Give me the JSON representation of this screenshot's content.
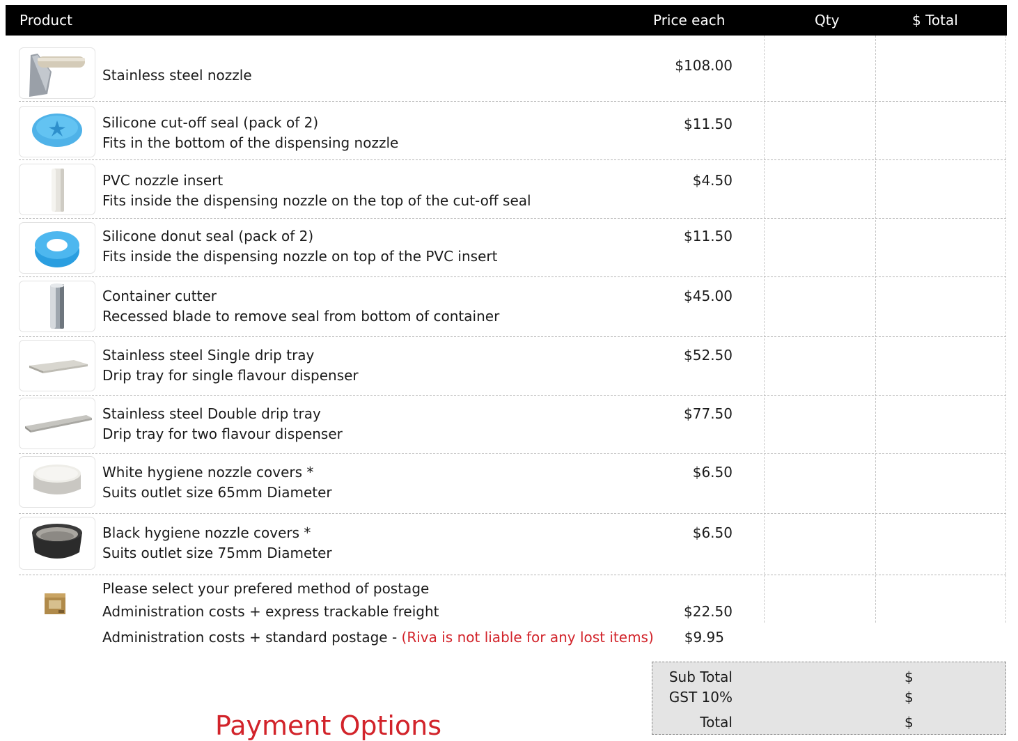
{
  "header": {
    "product": "Product",
    "price_each": "Price each",
    "qty": "Qty",
    "total": "$ Total"
  },
  "products": [
    {
      "name": "Stainless steel nozzle",
      "description": "",
      "price": "$108.00",
      "icon": "steel-nozzle"
    },
    {
      "name": "Silicone cut-off seal (pack of 2)",
      "description": "Fits in the bottom of the dispensing nozzle",
      "price": "$11.50",
      "icon": "cut-off-seal"
    },
    {
      "name": "PVC nozzle insert",
      "description": "Fits inside the dispensing nozzle on the top of the cut-off seal",
      "price": "$4.50",
      "icon": "pvc-insert"
    },
    {
      "name": "Silicone donut seal (pack of 2)",
      "description": "Fits inside the dispensing nozzle on top of the PVC insert",
      "price": "$11.50",
      "icon": "donut-seal"
    },
    {
      "name": "Container cutter",
      "description": "Recessed blade to remove seal from bottom of container",
      "price": "$45.00",
      "icon": "container-cutter"
    },
    {
      "name": "Stainless steel Single drip tray",
      "description": "Drip tray for single flavour dispenser",
      "price": "$52.50",
      "icon": "single-drip-tray"
    },
    {
      "name": "Stainless steel Double drip tray",
      "description": "Drip tray for two flavour dispenser",
      "price": "$77.50",
      "icon": "double-drip-tray"
    },
    {
      "name": "White hygiene nozzle covers *",
      "description": "Suits outlet size 65mm Diameter",
      "price": "$6.50",
      "icon": "white-nozzle-cover"
    },
    {
      "name": "Black hygiene nozzle covers *",
      "description": "Suits outlet size 75mm Diameter",
      "price": "$6.50",
      "icon": "black-nozzle-cover"
    }
  ],
  "postage": {
    "heading": "Please select your prefered method of postage",
    "express_label": "Administration costs + express trackable freight",
    "express_price": "$22.50",
    "standard_label": "Administration costs + standard postage  - ",
    "standard_warning": "(Riva is not liable for any lost items)",
    "standard_price": "$9.95",
    "icon": "parcel-box"
  },
  "totals": {
    "subtotal_label": "Sub Total",
    "gst_label": "GST 10%",
    "total_label": "Total",
    "currency": "$"
  },
  "payment_title": "Payment Options",
  "colors": {
    "header_bg": "#000000",
    "accent_red": "#d2232a",
    "totals_bg": "#e4e4e4"
  }
}
